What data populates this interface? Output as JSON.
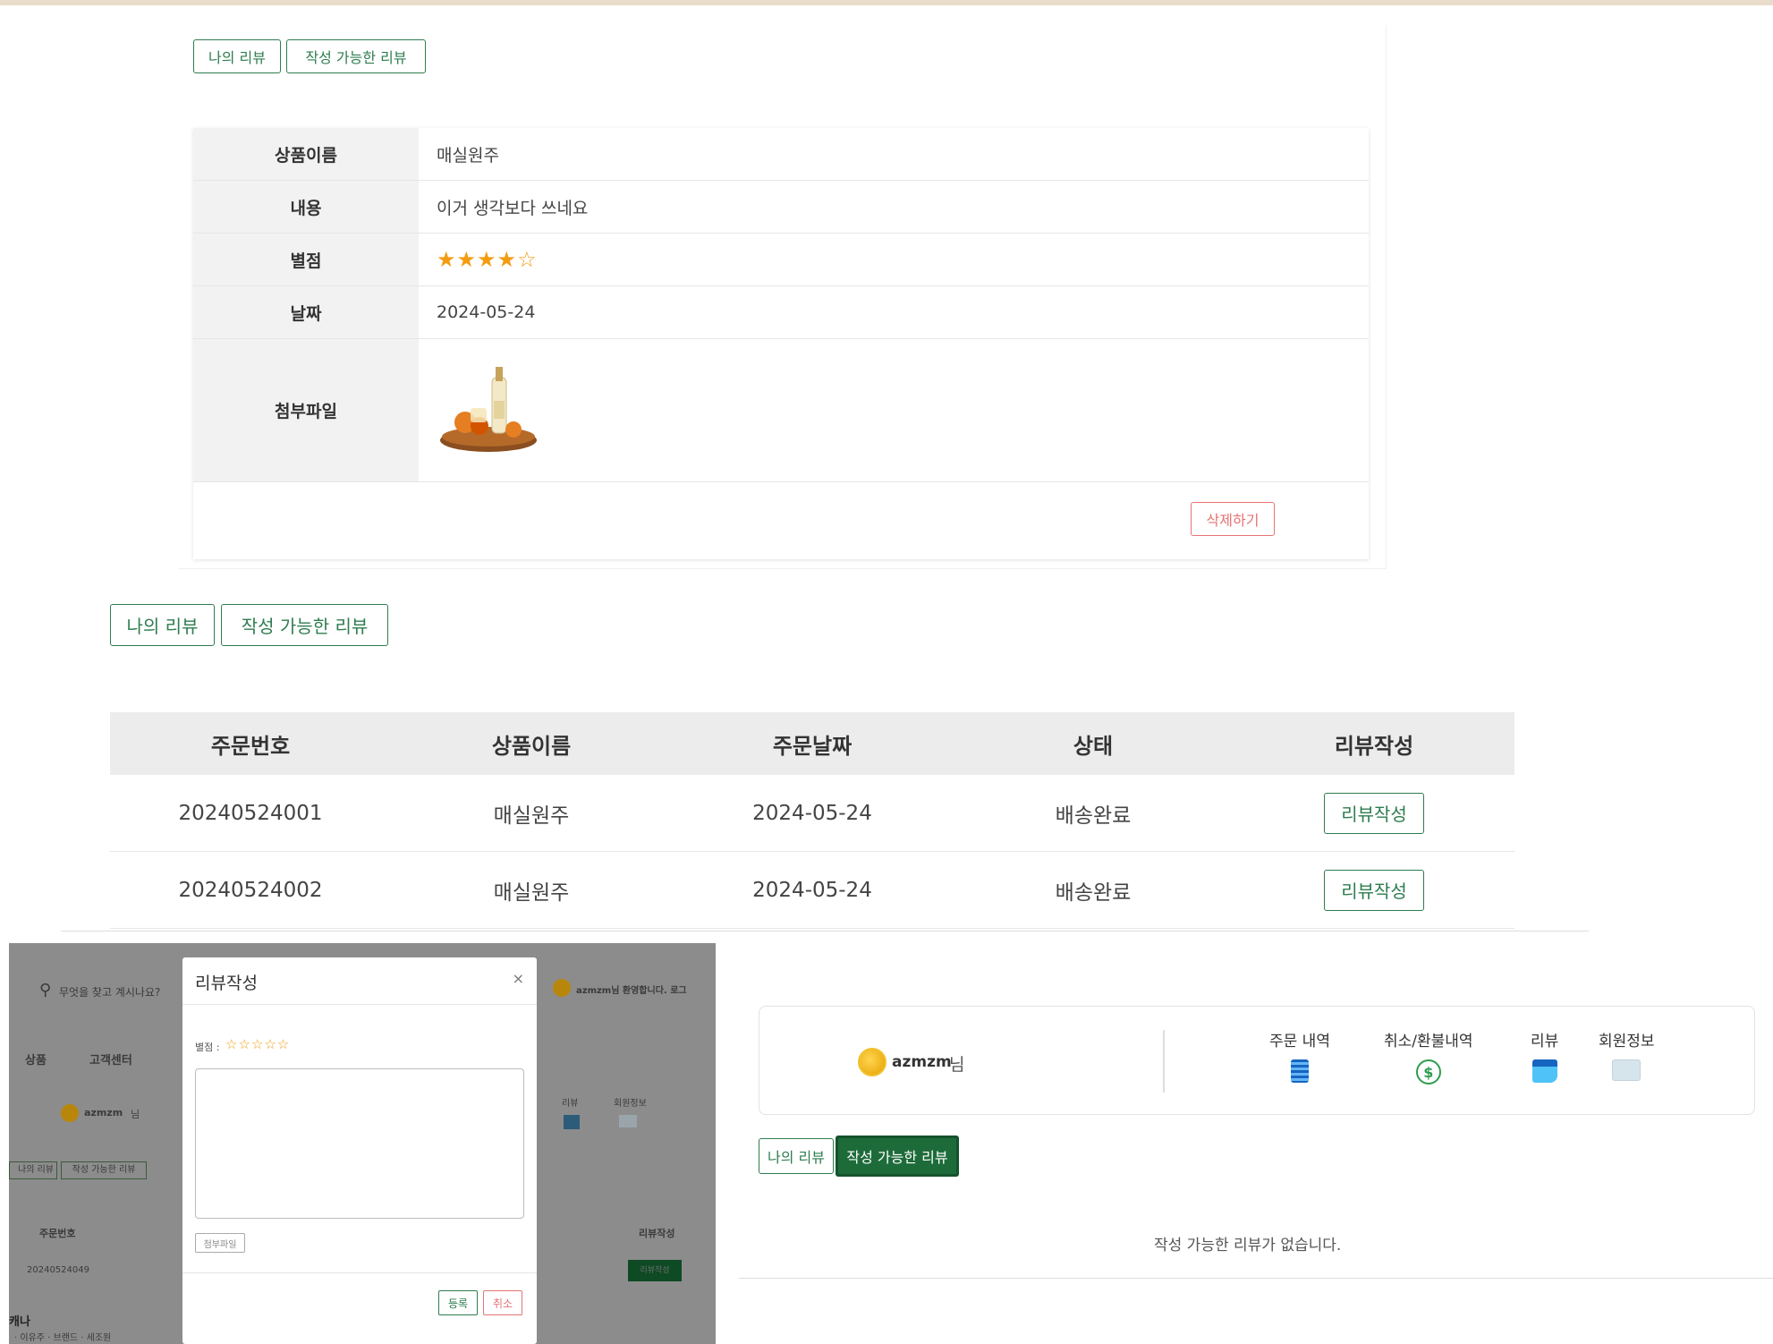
{
  "section1": {
    "tabs": {
      "my_reviews": "나의 리뷰",
      "writable_reviews": "작성 가능한 리뷰"
    },
    "detail": {
      "product_label": "상품이름",
      "product_value": "매실원주",
      "content_label": "내용",
      "content_value": "이거 생각보다 쓰네요",
      "rating_label": "별점",
      "rating_value": 4,
      "rating_max": 5,
      "rating_stars": "★★★★☆",
      "date_label": "날짜",
      "date_value": "2024-05-24",
      "attachment_label": "첨부파일"
    },
    "delete_button": "삭제하기"
  },
  "section2": {
    "tabs": {
      "my_reviews": "나의 리뷰",
      "writable_reviews": "작성 가능한 리뷰"
    },
    "columns": [
      "주문번호",
      "상품이름",
      "주문날짜",
      "상태",
      "리뷰작성"
    ],
    "rows": [
      {
        "order_no": "20240524001",
        "product": "매실원주",
        "date": "2024-05-24",
        "status": "배송완료",
        "action": "리뷰작성"
      },
      {
        "order_no": "20240524002",
        "product": "매실원주",
        "date": "2024-05-24",
        "status": "배송완료",
        "action": "리뷰작성"
      }
    ]
  },
  "section3": {
    "modal": {
      "title": "리뷰작성",
      "close": "×",
      "rating_label": "별점 :",
      "rating_stars": "☆☆☆☆☆",
      "attach_button": "첨부파일",
      "submit_button": "등록",
      "cancel_button": "취소"
    },
    "background": {
      "search_placeholder": "무엇을 찾고 계시나요?",
      "nav_product": "상품",
      "nav_support": "고객센터",
      "user_name": "azmzm",
      "user_suffix": "님",
      "greeting": "azmzm님 환영합니다. 로그",
      "menu_review": "리뷰",
      "menu_member": "회원정보",
      "tab_my": "나의 리뷰",
      "tab_writable": "작성 가능한 리뷰",
      "col_order": "주문번호",
      "col_review": "리뷰작성",
      "row_order": "20240524049",
      "row_action": "리뷰작성",
      "footer_1": "캐나",
      "footer_2": "· 이유주 · 브랜드 · 세조원"
    }
  },
  "section4": {
    "user_name": "azmzm",
    "user_suffix": "님",
    "menu": [
      {
        "label": "주문 내역",
        "icon": "order-list-icon"
      },
      {
        "label": "취소/환불내역",
        "icon": "refund-icon"
      },
      {
        "label": "리뷰",
        "icon": "review-icon"
      },
      {
        "label": "회원정보",
        "icon": "member-card-icon"
      }
    ],
    "tabs": {
      "my_reviews": "나의 리뷰",
      "writable_reviews": "작성 가능한 리뷰"
    },
    "empty_message": "작성 가능한 리뷰가 없습니다."
  },
  "colors": {
    "green": "#2e7d4f",
    "green_solid": "#1e6b3a",
    "star": "#f39c12",
    "red": "#e57373"
  }
}
